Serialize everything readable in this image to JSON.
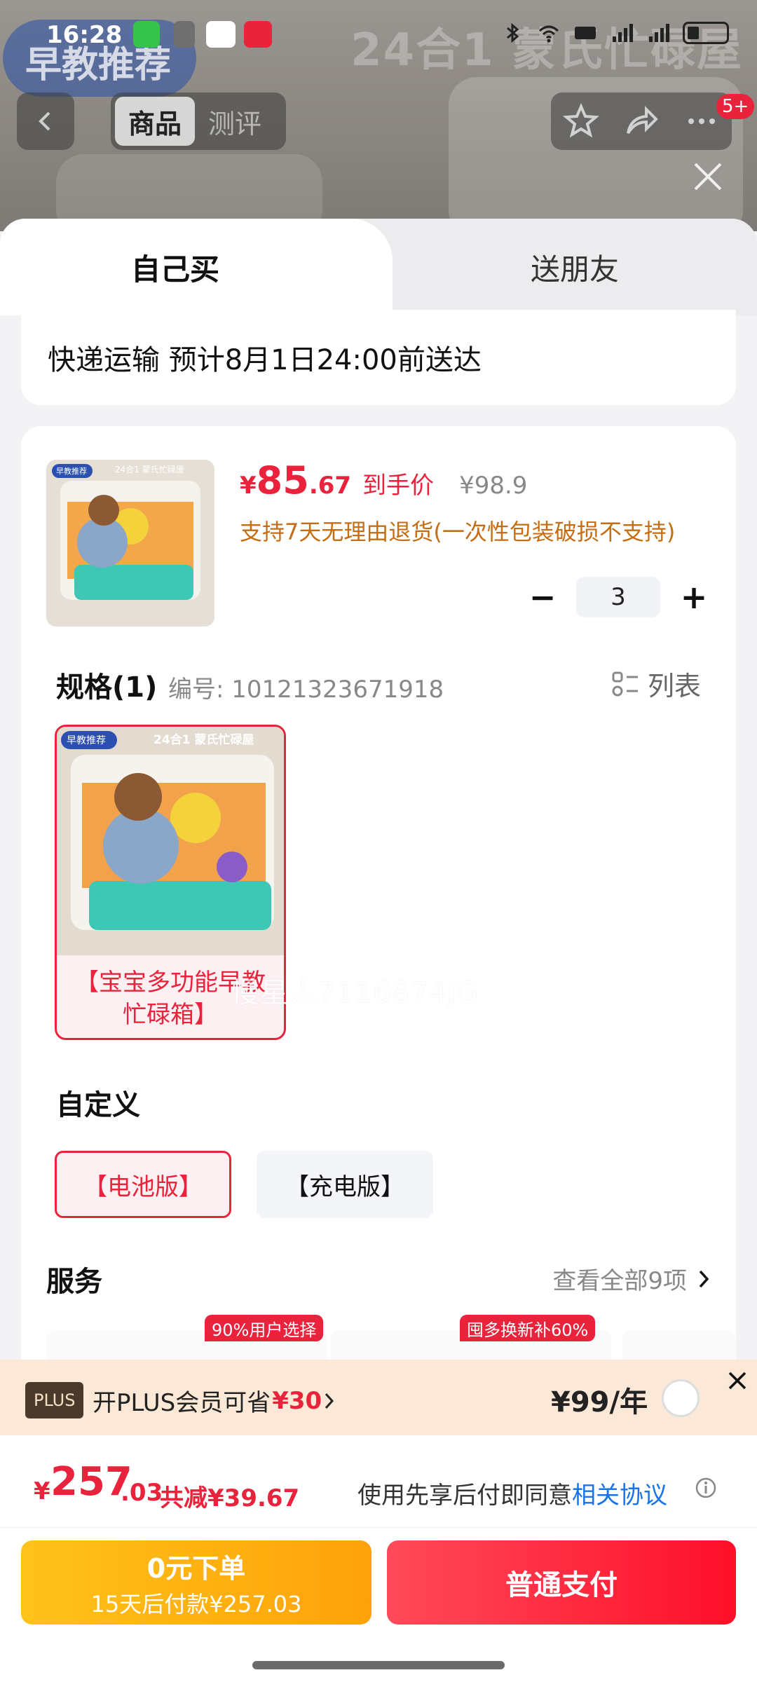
{
  "background": {
    "store_title": "24合1 蒙氏忙碌屋",
    "badge": "早教推荐",
    "nav_tabs": [
      "商品",
      "测评"
    ],
    "notification_count": "5+"
  },
  "status_bar": {
    "time": "16:28"
  },
  "sheet": {
    "tabs": {
      "self": "自己买",
      "gift": "送朋友"
    },
    "delivery": "快递运输 预计8月1日24:00前送达",
    "product": {
      "price_currency": "¥",
      "price_int": "85",
      "price_dec": ".67",
      "price_label": "到手价",
      "original_price": "¥98.9",
      "return_policy": "支持7天无理由退货(一次性包装破损不支持)",
      "quantity": "3",
      "qty_minus": "−",
      "qty_plus": "+"
    },
    "spec": {
      "title": "规格(1)",
      "code": "编号: 10121323671918",
      "list_label": "列表",
      "option_caption": "【宝宝多功能早教忙碌箱】",
      "thumb_badge": "早教推荐",
      "thumb_title": "24合1 蒙氏忙碌屋"
    },
    "watermark": "慢星人7116874JG",
    "custom": {
      "title": "自定义",
      "options": [
        "【电池版】",
        "【充电版】"
      ]
    },
    "service": {
      "title": "服务",
      "view_all": "查看全部9项",
      "tags": [
        "90%用户选择",
        "囤多换新补60%"
      ]
    }
  },
  "plus": {
    "logo": "PLUS",
    "text": "开PLUS会员可省",
    "save": "¥30",
    "price": "¥99/年"
  },
  "total": {
    "currency": "¥",
    "int": "257",
    "dec": ".03",
    "saved": "共减¥39.67",
    "agree_prefix": "使用先享后付即同意",
    "agree_link": "相关协议"
  },
  "buttons": {
    "zero_line1": "0元下单",
    "zero_line2": "15天后付款¥257.03",
    "pay": "普通支付"
  },
  "colors": {
    "accent_red": "#e8233b",
    "warning_orange": "#c46d12",
    "plus_bg": "#fbe8d7",
    "link_blue": "#1a73e8"
  }
}
